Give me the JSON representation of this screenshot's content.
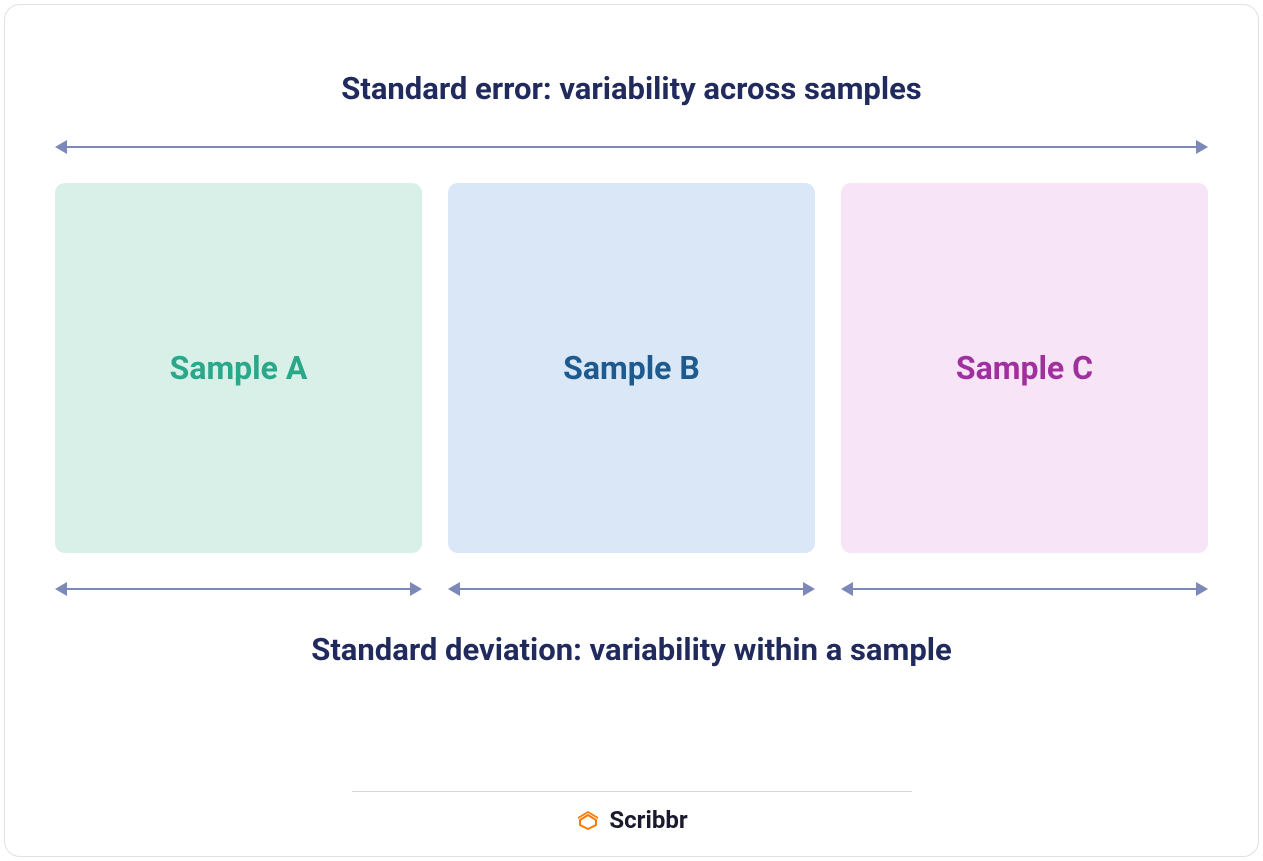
{
  "top_label": "Standard error: variability across samples",
  "bottom_label": "Standard deviation: variability within a sample",
  "samples": {
    "a": {
      "label": "Sample A",
      "bg_color": "#d9f0e9",
      "text_color": "#2aa88a"
    },
    "b": {
      "label": "Sample B",
      "bg_color": "#d9e7f7",
      "text_color": "#1e5a8e"
    },
    "c": {
      "label": "Sample C",
      "bg_color": "#f7e4f6",
      "text_color": "#a0309e"
    }
  },
  "arrow_color": "#7b88b8",
  "brand": {
    "name": "Scribbr",
    "icon_color": "#ff7a00"
  }
}
